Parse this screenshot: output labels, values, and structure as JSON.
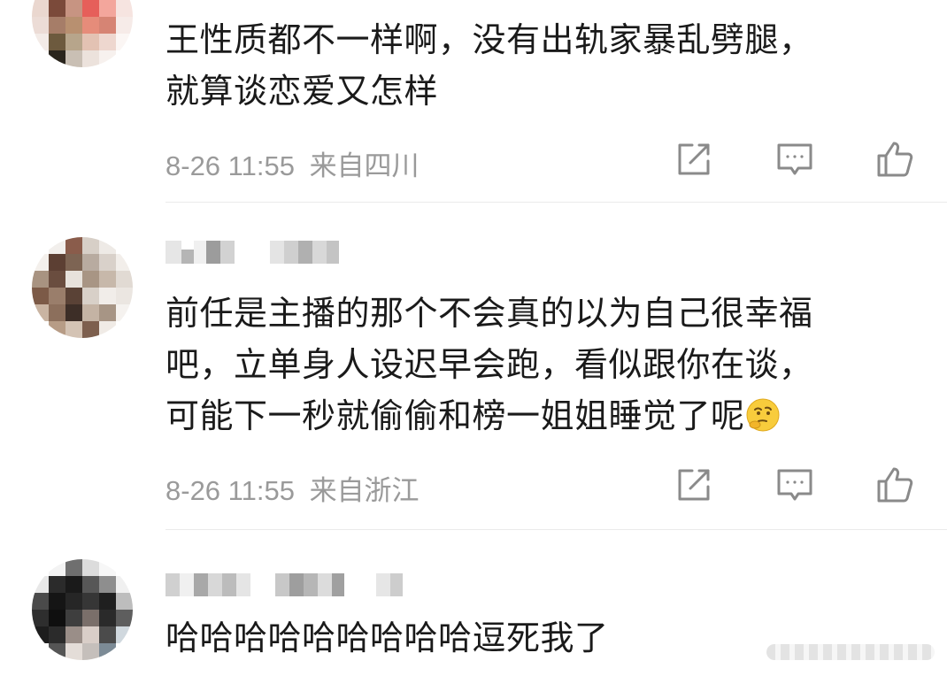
{
  "comments": [
    {
      "text_lines": [
        "王性质都不一样啊，没有出轨家暴乱劈腿，",
        "就算谈恋爱又怎样"
      ],
      "time": "8-26 11:55",
      "location": "来自四川"
    },
    {
      "text_lines": [
        "前任是主播的那个不会真的以为自己很幸福",
        "吧，立单身人设迟早会跑，看似跟你在谈，",
        "可能下一秒就偷偷和榜一姐姐睡觉了呢"
      ],
      "emoji": "thinking-face",
      "time": "8-26 11:55",
      "location": "来自浙江"
    },
    {
      "text_lines": [
        "哈哈哈哈哈哈哈哈哈逗死我了"
      ]
    }
  ],
  "icons": {
    "share": "share-icon",
    "reply": "comment-icon",
    "like": "thumbs-up-icon"
  },
  "colors": {
    "text": "#1a1a1a",
    "meta": "#9a9a9a",
    "icon": "#8a8a8a"
  }
}
